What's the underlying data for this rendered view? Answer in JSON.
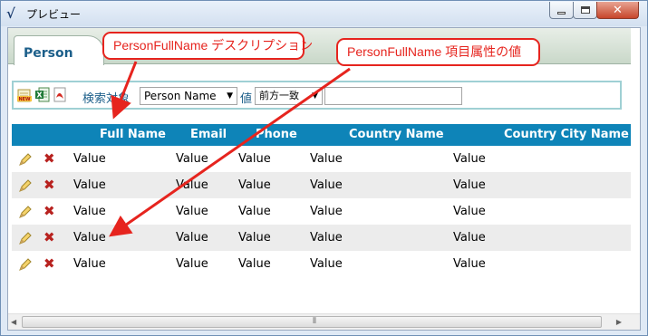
{
  "window": {
    "title": "プレビュー"
  },
  "tab": {
    "label": "Person"
  },
  "search": {
    "label": "検索対象",
    "field_value": "Person Name",
    "value_label": "値",
    "operator_value": "前方一致",
    "text_value": ""
  },
  "grid": {
    "columns": [
      "Full Name",
      "Email",
      "Phone",
      "Country Name",
      "Country City Name"
    ],
    "rows": [
      [
        "Value",
        "Value",
        "Value",
        "Value",
        "Value"
      ],
      [
        "Value",
        "Value",
        "Value",
        "Value",
        "Value"
      ],
      [
        "Value",
        "Value",
        "Value",
        "Value",
        "Value"
      ],
      [
        "Value",
        "Value",
        "Value",
        "Value",
        "Value"
      ],
      [
        "Value",
        "Value",
        "Value",
        "Value",
        "Value"
      ]
    ]
  },
  "callouts": {
    "description": "PersonFullName デスクリプション",
    "value": "PersonFullName 項目属性の値"
  },
  "colors": {
    "accent": "#1c5f8a",
    "header": "#0e84b8",
    "callout": "#e6241e",
    "delete": "#b8221f"
  }
}
